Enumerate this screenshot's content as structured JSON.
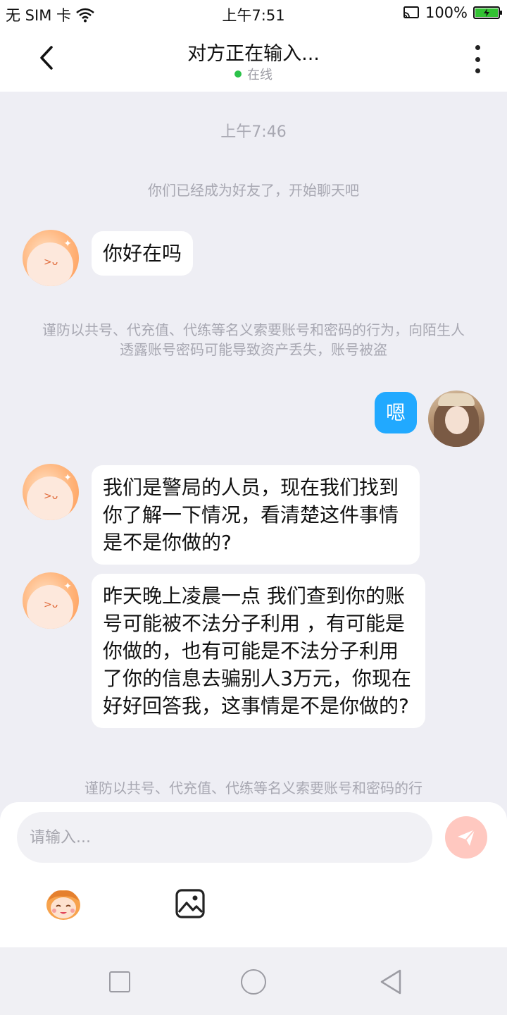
{
  "status_bar": {
    "carrier": "无 SIM 卡",
    "time": "上午7:51",
    "battery": "100%",
    "battery_level": 1.0,
    "icons": [
      "wifi-icon",
      "cast-icon",
      "battery-icon"
    ]
  },
  "header": {
    "title": "对方正在输入...",
    "status": "在线",
    "status_color": "#2bc24a",
    "icons": [
      "back-icon",
      "more-icon"
    ]
  },
  "chat": {
    "timestamp": "上午7:46",
    "system_friend": "你们已经成为好友了，开始聊天吧",
    "warning_1": "谨防以共号、代充值、代练等名义索要账号和密码的行为，向陌生人透露账号密码可能导致资产丢失，账号被盗",
    "warning_2": "谨防以共号、代充值、代练等名义索要账号和密码的行",
    "messages": [
      {
        "side": "left",
        "text": "你好在吗"
      },
      {
        "side": "right",
        "text": "嗯"
      },
      {
        "side": "left",
        "text": "我们是警局的人员，现在我们找到你了解一下情况，看清楚这件事情是不是你做的?"
      },
      {
        "side": "left",
        "text": "昨天晚上凌晨一点 我们查到你的账号可能被不法分子利用 ，有可能是你做的，也有可能是不法分子利用了你的信息去骗别人3万元，你现在好好回答我，这事情是不是你做的?"
      }
    ],
    "bubble_color_right": "#21a9ff"
  },
  "input": {
    "placeholder": "请输入...",
    "icons": [
      "send-icon",
      "emoji-icon",
      "image-icon"
    ]
  },
  "nav": {
    "icons": [
      "recent-apps-icon",
      "home-icon",
      "back-nav-icon"
    ]
  }
}
